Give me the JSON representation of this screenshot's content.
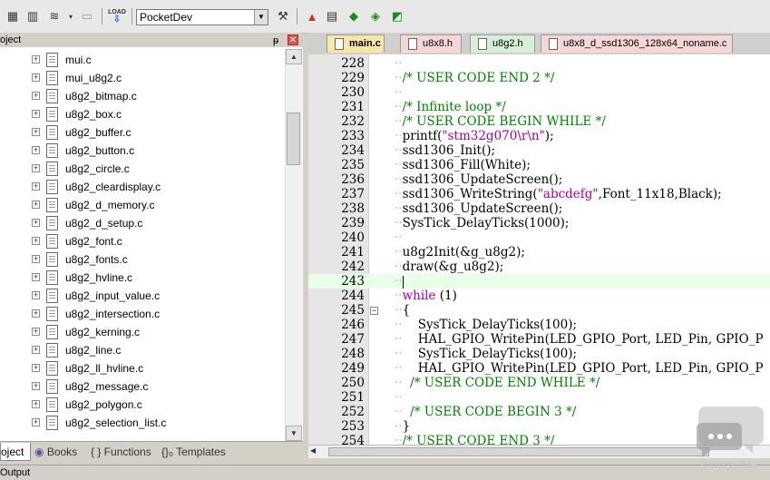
{
  "toolbar": {
    "target_combo_value": "PocketDev",
    "load_label": "LOAD"
  },
  "project_panel": {
    "title": "oject",
    "pin_label": "ᵽ",
    "close_label": "✕",
    "files": [
      "mui.c",
      "mui_u8g2.c",
      "u8g2_bitmap.c",
      "u8g2_box.c",
      "u8g2_buffer.c",
      "u8g2_button.c",
      "u8g2_circle.c",
      "u8g2_cleardisplay.c",
      "u8g2_d_memory.c",
      "u8g2_d_setup.c",
      "u8g2_font.c",
      "u8g2_fonts.c",
      "u8g2_hvline.c",
      "u8g2_input_value.c",
      "u8g2_intersection.c",
      "u8g2_kerning.c",
      "u8g2_line.c",
      "u8g2_ll_hvline.c",
      "u8g2_message.c",
      "u8g2_polygon.c",
      "u8g2_selection_list.c"
    ],
    "tabs": [
      {
        "label": "oject"
      },
      {
        "label": "Books"
      },
      {
        "label": "{ } Functions"
      },
      {
        "label": "{}₀ Templates"
      }
    ]
  },
  "editor_tabs": [
    {
      "label": "main.c"
    },
    {
      "label": "u8x8.h"
    },
    {
      "label": "u8g2.h"
    },
    {
      "label": "u8x8_d_ssd1306_128x64_noname.c"
    }
  ],
  "code_lines": [
    {
      "num": "228",
      "segments": []
    },
    {
      "num": "229",
      "segments": [
        {
          "t": "/* USER CODE END 2 */",
          "c": "cm"
        }
      ]
    },
    {
      "num": "230",
      "segments": []
    },
    {
      "num": "231",
      "segments": [
        {
          "t": "/* Infinite loop */",
          "c": "cm"
        }
      ]
    },
    {
      "num": "232",
      "segments": [
        {
          "t": "/* USER CODE BEGIN WHILE */",
          "c": "cm"
        }
      ]
    },
    {
      "num": "233",
      "segments": [
        {
          "t": "printf(",
          "c": ""
        },
        {
          "t": "\"stm32g070\\r\\n\"",
          "c": "str"
        },
        {
          "t": ");",
          "c": ""
        }
      ]
    },
    {
      "num": "234",
      "segments": [
        {
          "t": "ssd1306_Init();",
          "c": ""
        }
      ]
    },
    {
      "num": "235",
      "segments": [
        {
          "t": "ssd1306_Fill(White);",
          "c": ""
        }
      ]
    },
    {
      "num": "236",
      "segments": [
        {
          "t": "ssd1306_UpdateScreen();",
          "c": ""
        }
      ]
    },
    {
      "num": "237",
      "segments": [
        {
          "t": "ssd1306_WriteString(",
          "c": ""
        },
        {
          "t": "\"abcdefg\"",
          "c": "str"
        },
        {
          "t": ",Font_11x18,Black);",
          "c": ""
        }
      ]
    },
    {
      "num": "238",
      "segments": [
        {
          "t": "ssd1306_UpdateScreen();",
          "c": ""
        }
      ]
    },
    {
      "num": "239",
      "segments": [
        {
          "t": "SysTick_DelayTicks(1000);",
          "c": ""
        }
      ]
    },
    {
      "num": "240",
      "segments": []
    },
    {
      "num": "241",
      "segments": [
        {
          "t": "u8g2Init(&g_u8g2);",
          "c": ""
        }
      ]
    },
    {
      "num": "242",
      "segments": [
        {
          "t": "draw(&g_u8g2);",
          "c": ""
        }
      ]
    },
    {
      "num": "243",
      "segments": [],
      "current": true
    },
    {
      "num": "244",
      "segments": [
        {
          "t": "while",
          "c": "kw"
        },
        {
          "t": " (1)",
          "c": ""
        }
      ]
    },
    {
      "num": "245",
      "segments": [
        {
          "t": "{",
          "c": ""
        }
      ],
      "fold": true
    },
    {
      "num": "246",
      "segments": [
        {
          "t": "    SysTick_DelayTicks(100);",
          "c": ""
        }
      ]
    },
    {
      "num": "247",
      "segments": [
        {
          "t": "    HAL_GPIO_WritePin(LED_GPIO_Port, LED_Pin, GPIO_P",
          "c": ""
        }
      ]
    },
    {
      "num": "248",
      "segments": [
        {
          "t": "    SysTick_DelayTicks(100);",
          "c": ""
        }
      ]
    },
    {
      "num": "249",
      "segments": [
        {
          "t": "    HAL_GPIO_WritePin(LED_GPIO_Port, LED_Pin, GPIO_P",
          "c": ""
        }
      ]
    },
    {
      "num": "250",
      "segments": [
        {
          "t": "  /* USER CODE END WHILE */",
          "c": "cm"
        }
      ]
    },
    {
      "num": "251",
      "segments": []
    },
    {
      "num": "252",
      "segments": [
        {
          "t": "  /* USER CODE BEGIN 3 */",
          "c": "cm"
        }
      ]
    },
    {
      "num": "253",
      "segments": [
        {
          "t": "}",
          "c": ""
        }
      ]
    },
    {
      "num": "254",
      "segments": [
        {
          "t": "/* USER CODE END 3 */",
          "c": "cm"
        }
      ]
    }
  ],
  "status": {
    "output_label": "Output"
  },
  "watermark": {
    "text": "ST中文论坛"
  }
}
